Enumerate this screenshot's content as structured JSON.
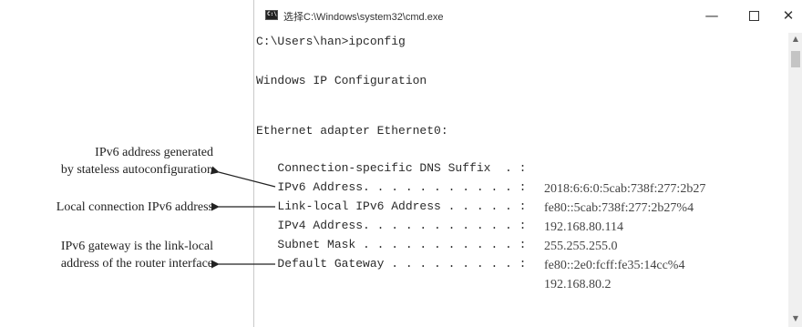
{
  "window": {
    "icon_label": "C:\\",
    "title": "选择C:\\Windows\\system32\\cmd.exe",
    "controls": {
      "minimize": "—",
      "maximize": "",
      "close": "✕"
    }
  },
  "console": {
    "prompt": "C:\\Users\\han>ipconfig",
    "header": "Windows IP Configuration",
    "adapter": "Ethernet adapter Ethernet0:",
    "dns_suffix": "   Connection-specific DNS Suffix  . :",
    "rows": [
      {
        "label": "   IPv6 Address. . . . . . . . . . . :",
        "value": "2018:6:6:0:5cab:738f:277:2b27"
      },
      {
        "label": "   Link-local IPv6 Address . . . . . :",
        "value": "fe80::5cab:738f:277:2b27%4"
      },
      {
        "label": "   IPv4 Address. . . . . . . . . . . :",
        "value": "192.168.80.114"
      },
      {
        "label": "   Subnet Mask . . . . . . . . . . . :",
        "value": "255.255.255.0"
      },
      {
        "label": "   Default Gateway . . . . . . . . . :",
        "value": "fe80::2e0:fcff:fe35:14cc%4"
      }
    ],
    "gateway_ipv4": "192.168.80.2"
  },
  "scrollbar": {
    "up": "▲",
    "down": "▼"
  },
  "annotations": [
    {
      "line1": "IPv6 address generated",
      "line2": "by stateless autoconfiguration",
      "target": "IPv6 Address"
    },
    {
      "line1": "Local connection IPv6 address",
      "line2": "",
      "target": "Link-local IPv6 Address"
    },
    {
      "line1": "IPv6 gateway is the link-local",
      "line2": "address of the router interface",
      "target": "Default Gateway"
    }
  ]
}
